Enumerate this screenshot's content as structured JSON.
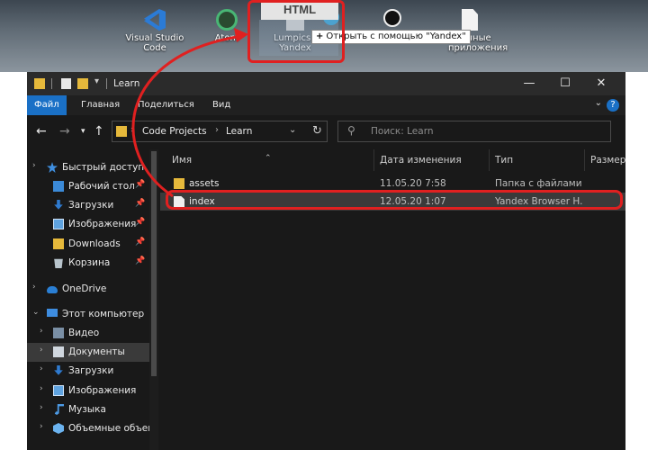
{
  "desktop": {
    "icons": [
      {
        "label": "Visual Studio Code",
        "icon": "vscode-icon"
      },
      {
        "label": "Atom",
        "icon": "atom-icon"
      },
      {
        "label": "Lumpics - Yandex",
        "icon": "yandex-icon"
      },
      {
        "label": "",
        "icon": "telegram-icon"
      },
      {
        "label": "",
        "icon": "obs-icon"
      },
      {
        "label": "енные приложения",
        "icon": "file-icon"
      }
    ],
    "drag_label": "HTML",
    "drop_tooltip": "Открыть с помощью \"Yandex\"",
    "drop_plus": "+"
  },
  "window": {
    "title": "Learn",
    "ribbon_tabs": [
      "Файл",
      "Главная",
      "Поделиться",
      "Вид"
    ],
    "active_tab": "Файл",
    "controls": {
      "minimize": "—",
      "maximize": "☐",
      "close": "✕"
    },
    "help": "?",
    "address": {
      "crumbs": [
        "Code Projects",
        "Learn"
      ]
    },
    "search": {
      "placeholder": "Поиск: Learn"
    }
  },
  "nav": {
    "items": [
      {
        "label": "Быстрый доступ",
        "icon": "star-icon",
        "pinned": false
      },
      {
        "label": "Рабочий стол",
        "icon": "desktop-icon",
        "pinned": true
      },
      {
        "label": "Загрузки",
        "icon": "downloads-icon",
        "pinned": true
      },
      {
        "label": "Изображения",
        "icon": "pictures-icon",
        "pinned": true
      },
      {
        "label": "Downloads",
        "icon": "folder-icon",
        "pinned": true
      },
      {
        "label": "Корзина",
        "icon": "recycle-bin-icon",
        "pinned": true
      },
      {
        "label": "OneDrive",
        "icon": "onedrive-icon",
        "pinned": false
      },
      {
        "label": "Этот компьютер",
        "icon": "computer-icon",
        "pinned": false
      },
      {
        "label": "Видео",
        "icon": "video-icon",
        "pinned": false
      },
      {
        "label": "Документы",
        "icon": "documents-icon",
        "pinned": false
      },
      {
        "label": "Загрузки",
        "icon": "downloads-icon",
        "pinned": false
      },
      {
        "label": "Изображения",
        "icon": "pictures-icon",
        "pinned": false
      },
      {
        "label": "Музыка",
        "icon": "music-icon",
        "pinned": false
      },
      {
        "label": "Объемные объек",
        "icon": "3d-objects-icon",
        "pinned": false
      }
    ]
  },
  "files": {
    "columns": [
      "Имя",
      "Дата изменения",
      "Тип",
      "Размер"
    ],
    "rows": [
      {
        "name": "assets",
        "date": "11.05.20 7:58",
        "type": "Папка с файлами",
        "icon": "folder-icon"
      },
      {
        "name": "index",
        "date": "12.05.20 1:07",
        "type": "Yandex Browser H...",
        "icon": "html-file-icon"
      }
    ]
  },
  "colors": {
    "accent": "#1a70c6",
    "highlight": "#e02020",
    "window_bg": "#191919"
  }
}
